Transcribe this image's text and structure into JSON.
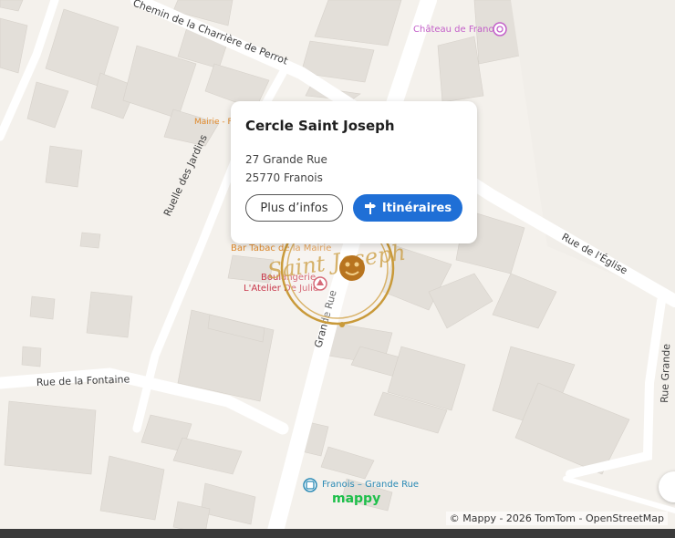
{
  "map": {
    "streets": {
      "charriere": "Chemin de la Charrière de Perrot",
      "jardins": "Ruelle des Jardins",
      "eglise": "Rue de l'Église",
      "grande_rue": "Grande Rue",
      "grande_rue_east": "Rue Grande",
      "fontaine": "Rue de la Fontaine"
    },
    "pois": {
      "chateau": "Château de Franois",
      "mairie": "Mairie - F",
      "bar_tabac": "Bar Tabac de la Mairie",
      "boulangerie_1": "Boulangerie",
      "boulangerie_2": "L'Atelier De Julie",
      "bus_stop": "Franois – Grande Rue"
    },
    "marker": {
      "logo_text": "Saint Joseph",
      "colors": {
        "ring": "#c99a3a",
        "accent": "#b8741f"
      }
    },
    "colors": {
      "background": "#f4f1ec",
      "buildings": "#e3dfd9",
      "road": "#ffffff",
      "poi_orange": "#e08a2c",
      "poi_red": "#c8384b",
      "poi_pink": "#c35fc9",
      "transit": "#2a8ab5"
    }
  },
  "popup": {
    "title": "Cercle Saint Joseph",
    "address_line1": "27 Grande Rue",
    "address_line2": "25770 Franois",
    "more_label": "Plus d’infos",
    "route_label": "Itinéraires",
    "route_icon": "signpost-icon"
  },
  "logo": "mappy",
  "attribution": "© Mappy - 2026 TomTom - OpenStreetMap"
}
